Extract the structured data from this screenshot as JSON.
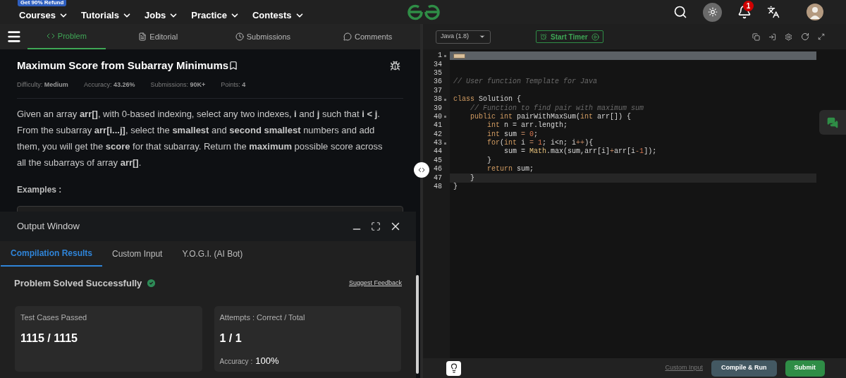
{
  "nav": {
    "badge": "Get 90% Refund",
    "items": [
      "Courses",
      "Tutorials",
      "Jobs",
      "Practice",
      "Contests"
    ],
    "notification_count": "1"
  },
  "problem_tabs": [
    {
      "label": "Problem",
      "selected": true
    },
    {
      "label": "Editorial",
      "selected": false
    },
    {
      "label": "Submissions",
      "selected": false
    },
    {
      "label": "Comments",
      "selected": false
    }
  ],
  "problem": {
    "title": "Maximum Score from Subarray Minimums",
    "meta": [
      {
        "label": "Difficulty:",
        "value": "Medium"
      },
      {
        "label": "Accuracy:",
        "value": "43.26%"
      },
      {
        "label": "Submissions:",
        "value": "90K+"
      },
      {
        "label": "Points:",
        "value": "4"
      }
    ],
    "description": "Given an array **arr[]**, with 0-based indexing, select any two indexes, **i** and **j** such that **i < j**. From the subarray **arr[i...j]**, select the **smallest** and **second smallest** numbers and add them, you will get the **score** for that subarray. Return the **maximum** possible score across all the subarrays of array **arr[]**.",
    "examples_heading": "Examples :"
  },
  "output_window": {
    "title": "Output Window",
    "tabs": [
      {
        "label": "Compilation Results",
        "selected": true
      },
      {
        "label": "Custom Input",
        "selected": false
      },
      {
        "label": "Y.O.G.I. (AI Bot)",
        "selected": false
      }
    ],
    "status": "Problem Solved Successfully",
    "feedback_link": "Suggest Feedback",
    "cards": [
      {
        "label": "Test Cases Passed",
        "value": "1115 / 1115"
      },
      {
        "label": "Attempts : Correct / Total",
        "value": "1 / 1",
        "extra_label": "Accuracy :",
        "extra_value": "100%"
      }
    ]
  },
  "editor": {
    "language": "Java (1.8)",
    "timer_button": "Start Timer",
    "lines": [
      {
        "number": "1",
        "foldable": true,
        "folded": true,
        "active": false
      },
      {
        "number": "34",
        "foldable": false,
        "folded": false,
        "active": false
      },
      {
        "number": "35",
        "foldable": false,
        "folded": false,
        "active": false
      },
      {
        "number": "36",
        "foldable": false,
        "folded": false,
        "active": false,
        "tokens": [
          {
            "kind": "comment",
            "t": "// User function Template for Java"
          }
        ]
      },
      {
        "number": "37",
        "foldable": false,
        "folded": false,
        "active": false
      },
      {
        "number": "38",
        "foldable": true,
        "folded": false,
        "active": false,
        "tokens": [
          {
            "kind": "kw",
            "t": "class"
          },
          {
            "kind": "plain",
            "t": " Solution {"
          }
        ]
      },
      {
        "number": "39",
        "foldable": false,
        "folded": false,
        "active": false,
        "tokens": [
          {
            "kind": "comment",
            "t": "    // Function to find pair with maximum sum"
          }
        ]
      },
      {
        "number": "40",
        "foldable": true,
        "folded": false,
        "active": false,
        "tokens": [
          {
            "kind": "kw",
            "t": "    public"
          },
          {
            "kind": "kw",
            "t": " int"
          },
          {
            "kind": "plain",
            "t": " pairWithMaxSum("
          },
          {
            "kind": "kw",
            "t": "int"
          },
          {
            "kind": "plain",
            "t": " arr[]) {"
          }
        ]
      },
      {
        "number": "41",
        "foldable": false,
        "folded": false,
        "active": false,
        "tokens": [
          {
            "kind": "kw",
            "t": "        int"
          },
          {
            "kind": "plain",
            "t": " n = arr.length;"
          }
        ]
      },
      {
        "number": "42",
        "foldable": false,
        "folded": false,
        "active": false,
        "tokens": [
          {
            "kind": "kw",
            "t": "        int"
          },
          {
            "kind": "plain",
            "t": " sum "
          },
          {
            "kind": "op",
            "t": "="
          },
          {
            "kind": "num",
            "t": " 0"
          },
          {
            "kind": "plain",
            "t": ";"
          }
        ]
      },
      {
        "number": "43",
        "foldable": true,
        "folded": false,
        "active": false,
        "tokens": [
          {
            "kind": "kw",
            "t": "        for"
          },
          {
            "kind": "plain",
            "t": "("
          },
          {
            "kind": "kw",
            "t": "int"
          },
          {
            "kind": "plain",
            "t": " i "
          },
          {
            "kind": "op",
            "t": "="
          },
          {
            "kind": "num",
            "t": " 1"
          },
          {
            "kind": "plain",
            "t": "; i<n; i"
          },
          {
            "kind": "op",
            "t": "++"
          },
          {
            "kind": "plain",
            "t": "){"
          }
        ]
      },
      {
        "number": "44",
        "foldable": false,
        "folded": false,
        "active": false,
        "tokens": [
          {
            "kind": "plain",
            "t": "            sum = "
          },
          {
            "kind": "fn",
            "t": "Math"
          },
          {
            "kind": "plain",
            "t": ".max(sum,arr[i]"
          },
          {
            "kind": "op",
            "t": "+"
          },
          {
            "kind": "plain",
            "t": "arr[i"
          },
          {
            "kind": "op",
            "t": "-"
          },
          {
            "kind": "num",
            "t": "1"
          },
          {
            "kind": "plain",
            "t": "]);"
          }
        ]
      },
      {
        "number": "45",
        "foldable": false,
        "folded": false,
        "active": false,
        "tokens": [
          {
            "kind": "plain",
            "t": "        }"
          }
        ]
      },
      {
        "number": "46",
        "foldable": false,
        "folded": false,
        "active": false,
        "tokens": [
          {
            "kind": "kw",
            "t": "        return"
          },
          {
            "kind": "plain",
            "t": " sum;"
          }
        ]
      },
      {
        "number": "47",
        "foldable": false,
        "folded": false,
        "active": true,
        "tokens": [
          {
            "kind": "plain",
            "t": "    }"
          }
        ]
      },
      {
        "number": "48",
        "foldable": false,
        "folded": false,
        "active": false,
        "tokens": [
          {
            "kind": "plain",
            "t": "}"
          }
        ]
      }
    ],
    "custom_input_link": "Custom Input",
    "compile_button": "Compile & Run",
    "submit_button": "Submit"
  }
}
